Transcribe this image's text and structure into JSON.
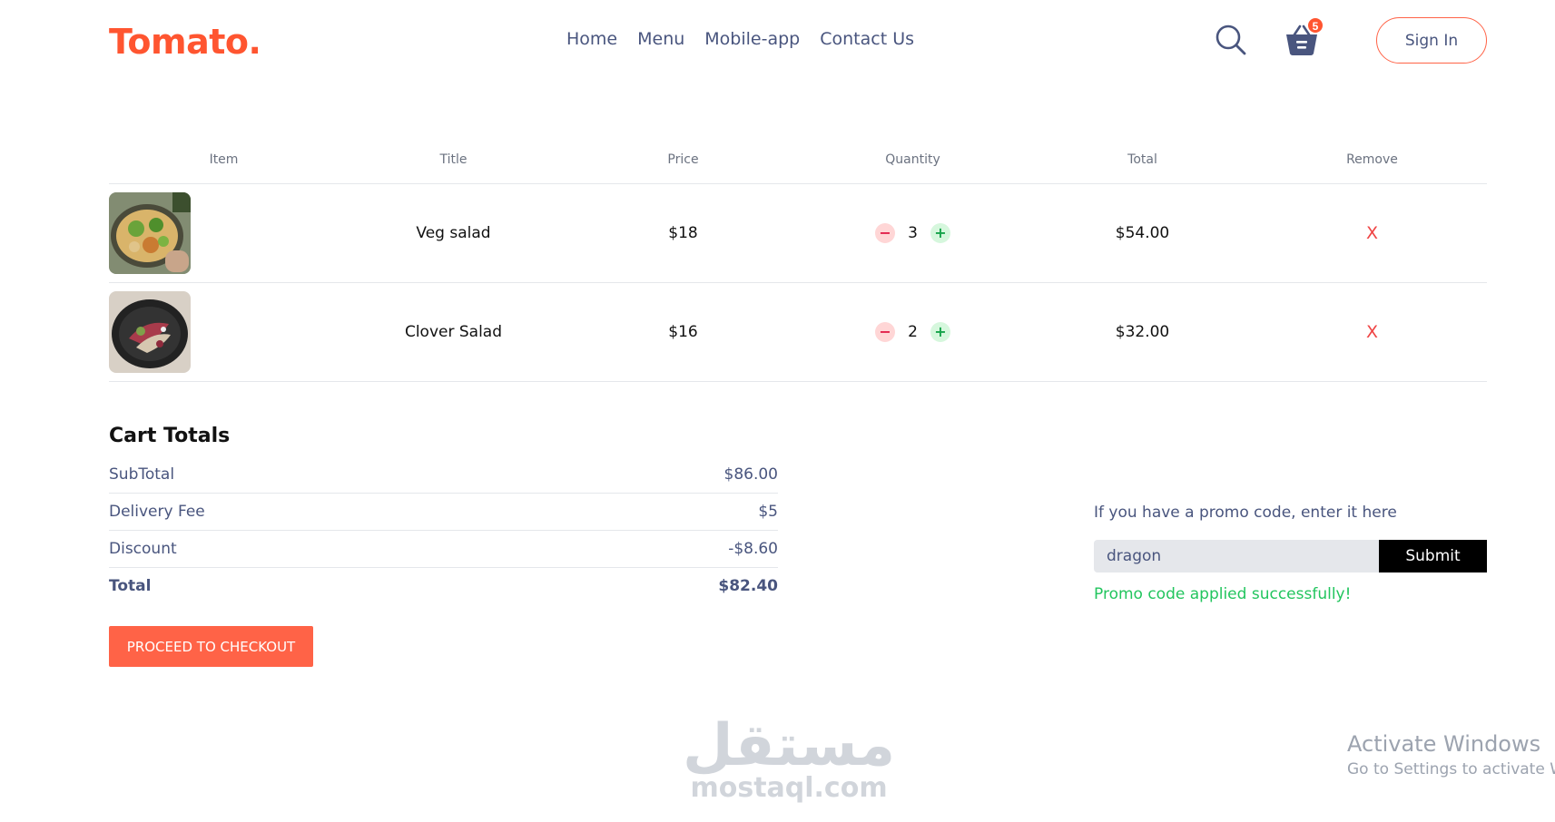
{
  "navbar": {
    "logo": "Tomato.",
    "menu": [
      "Home",
      "Menu",
      "Mobile-app",
      "Contact Us"
    ],
    "cart_count": "5",
    "signin_label": "Sign In"
  },
  "cart": {
    "headers": [
      "Item",
      "Title",
      "Price",
      "Quantity",
      "Total",
      "Remove"
    ],
    "items": [
      {
        "title": "Veg salad",
        "price": "$18",
        "quantity": "3",
        "total": "$54.00",
        "remove": "X"
      },
      {
        "title": "Clover Salad",
        "price": "$16",
        "quantity": "2",
        "total": "$32.00",
        "remove": "X"
      }
    ]
  },
  "totals": {
    "heading": "Cart Totals",
    "subtotal_label": "SubTotal",
    "subtotal": "$86.00",
    "delivery_label": "Delivery Fee",
    "delivery": "$5",
    "discount_label": "Discount",
    "discount": "-$8.60",
    "total_label": "Total",
    "total": "$82.40",
    "checkout_label": "PROCEED TO CHECKOUT"
  },
  "promo": {
    "prompt": "If you have a promo code, enter it here",
    "value": "dragon",
    "submit_label": "Submit",
    "message": "Promo code applied successfully!"
  },
  "watermarks": {
    "arabic": "مستقل",
    "site": "mostaql.com",
    "activate_title": "Activate Windows",
    "activate_sub": "Go to Settings to activate Windows."
  },
  "colors": {
    "brand": "#ff5530",
    "accent_button": "#ff6347",
    "success": "#22c55e",
    "remove": "#ef4444"
  },
  "icons": [
    "search-icon",
    "basket-icon",
    "minus-icon",
    "plus-icon"
  ]
}
